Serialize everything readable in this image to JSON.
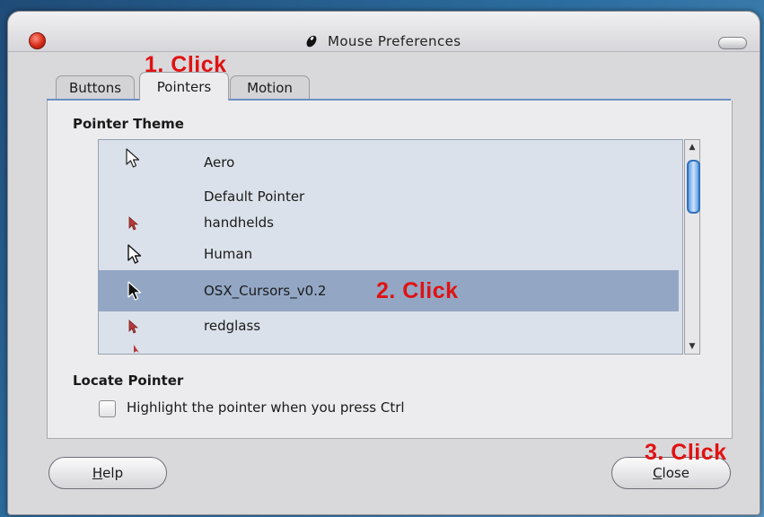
{
  "window": {
    "title": "Mouse Preferences",
    "title_icon": "mouse-icon",
    "close_icon": "close-icon",
    "minimize_icon": "minimize-icon"
  },
  "tabs": [
    {
      "label": "Buttons",
      "active": false
    },
    {
      "label": "Pointers",
      "active": true
    },
    {
      "label": "Motion",
      "active": false
    }
  ],
  "pointer_theme": {
    "heading": "Pointer Theme",
    "items": [
      {
        "label": "Aero",
        "icon": "white-arrow-cursor-icon",
        "selected": false
      },
      {
        "label": "Default Pointer",
        "icon": "",
        "selected": false
      },
      {
        "label": "handhelds",
        "icon": "red-arrow-cursor-icon",
        "selected": false
      },
      {
        "label": "Human",
        "icon": "white-arrow-cursor-icon",
        "selected": false
      },
      {
        "label": "OSX_Cursors_v0.2",
        "icon": "black-arrow-cursor-icon",
        "selected": true
      },
      {
        "label": "redglass",
        "icon": "red-arrow-cursor-icon",
        "selected": false
      }
    ]
  },
  "locate_pointer": {
    "heading": "Locate Pointer",
    "checkbox_label": "Highlight the pointer when you press Ctrl",
    "checked": false
  },
  "buttons": {
    "help": {
      "mnemonic": "H",
      "rest": "elp"
    },
    "close": {
      "mnemonic": "C",
      "rest": "lose"
    }
  },
  "annotations": {
    "step1": "1. Click",
    "step2": "2. Click",
    "step3": "3. Click",
    "color": "#e01212"
  },
  "colors": {
    "selected_row": "#93a7c5",
    "list_bg": "#dbe1ea",
    "accent": "#3272b8"
  }
}
